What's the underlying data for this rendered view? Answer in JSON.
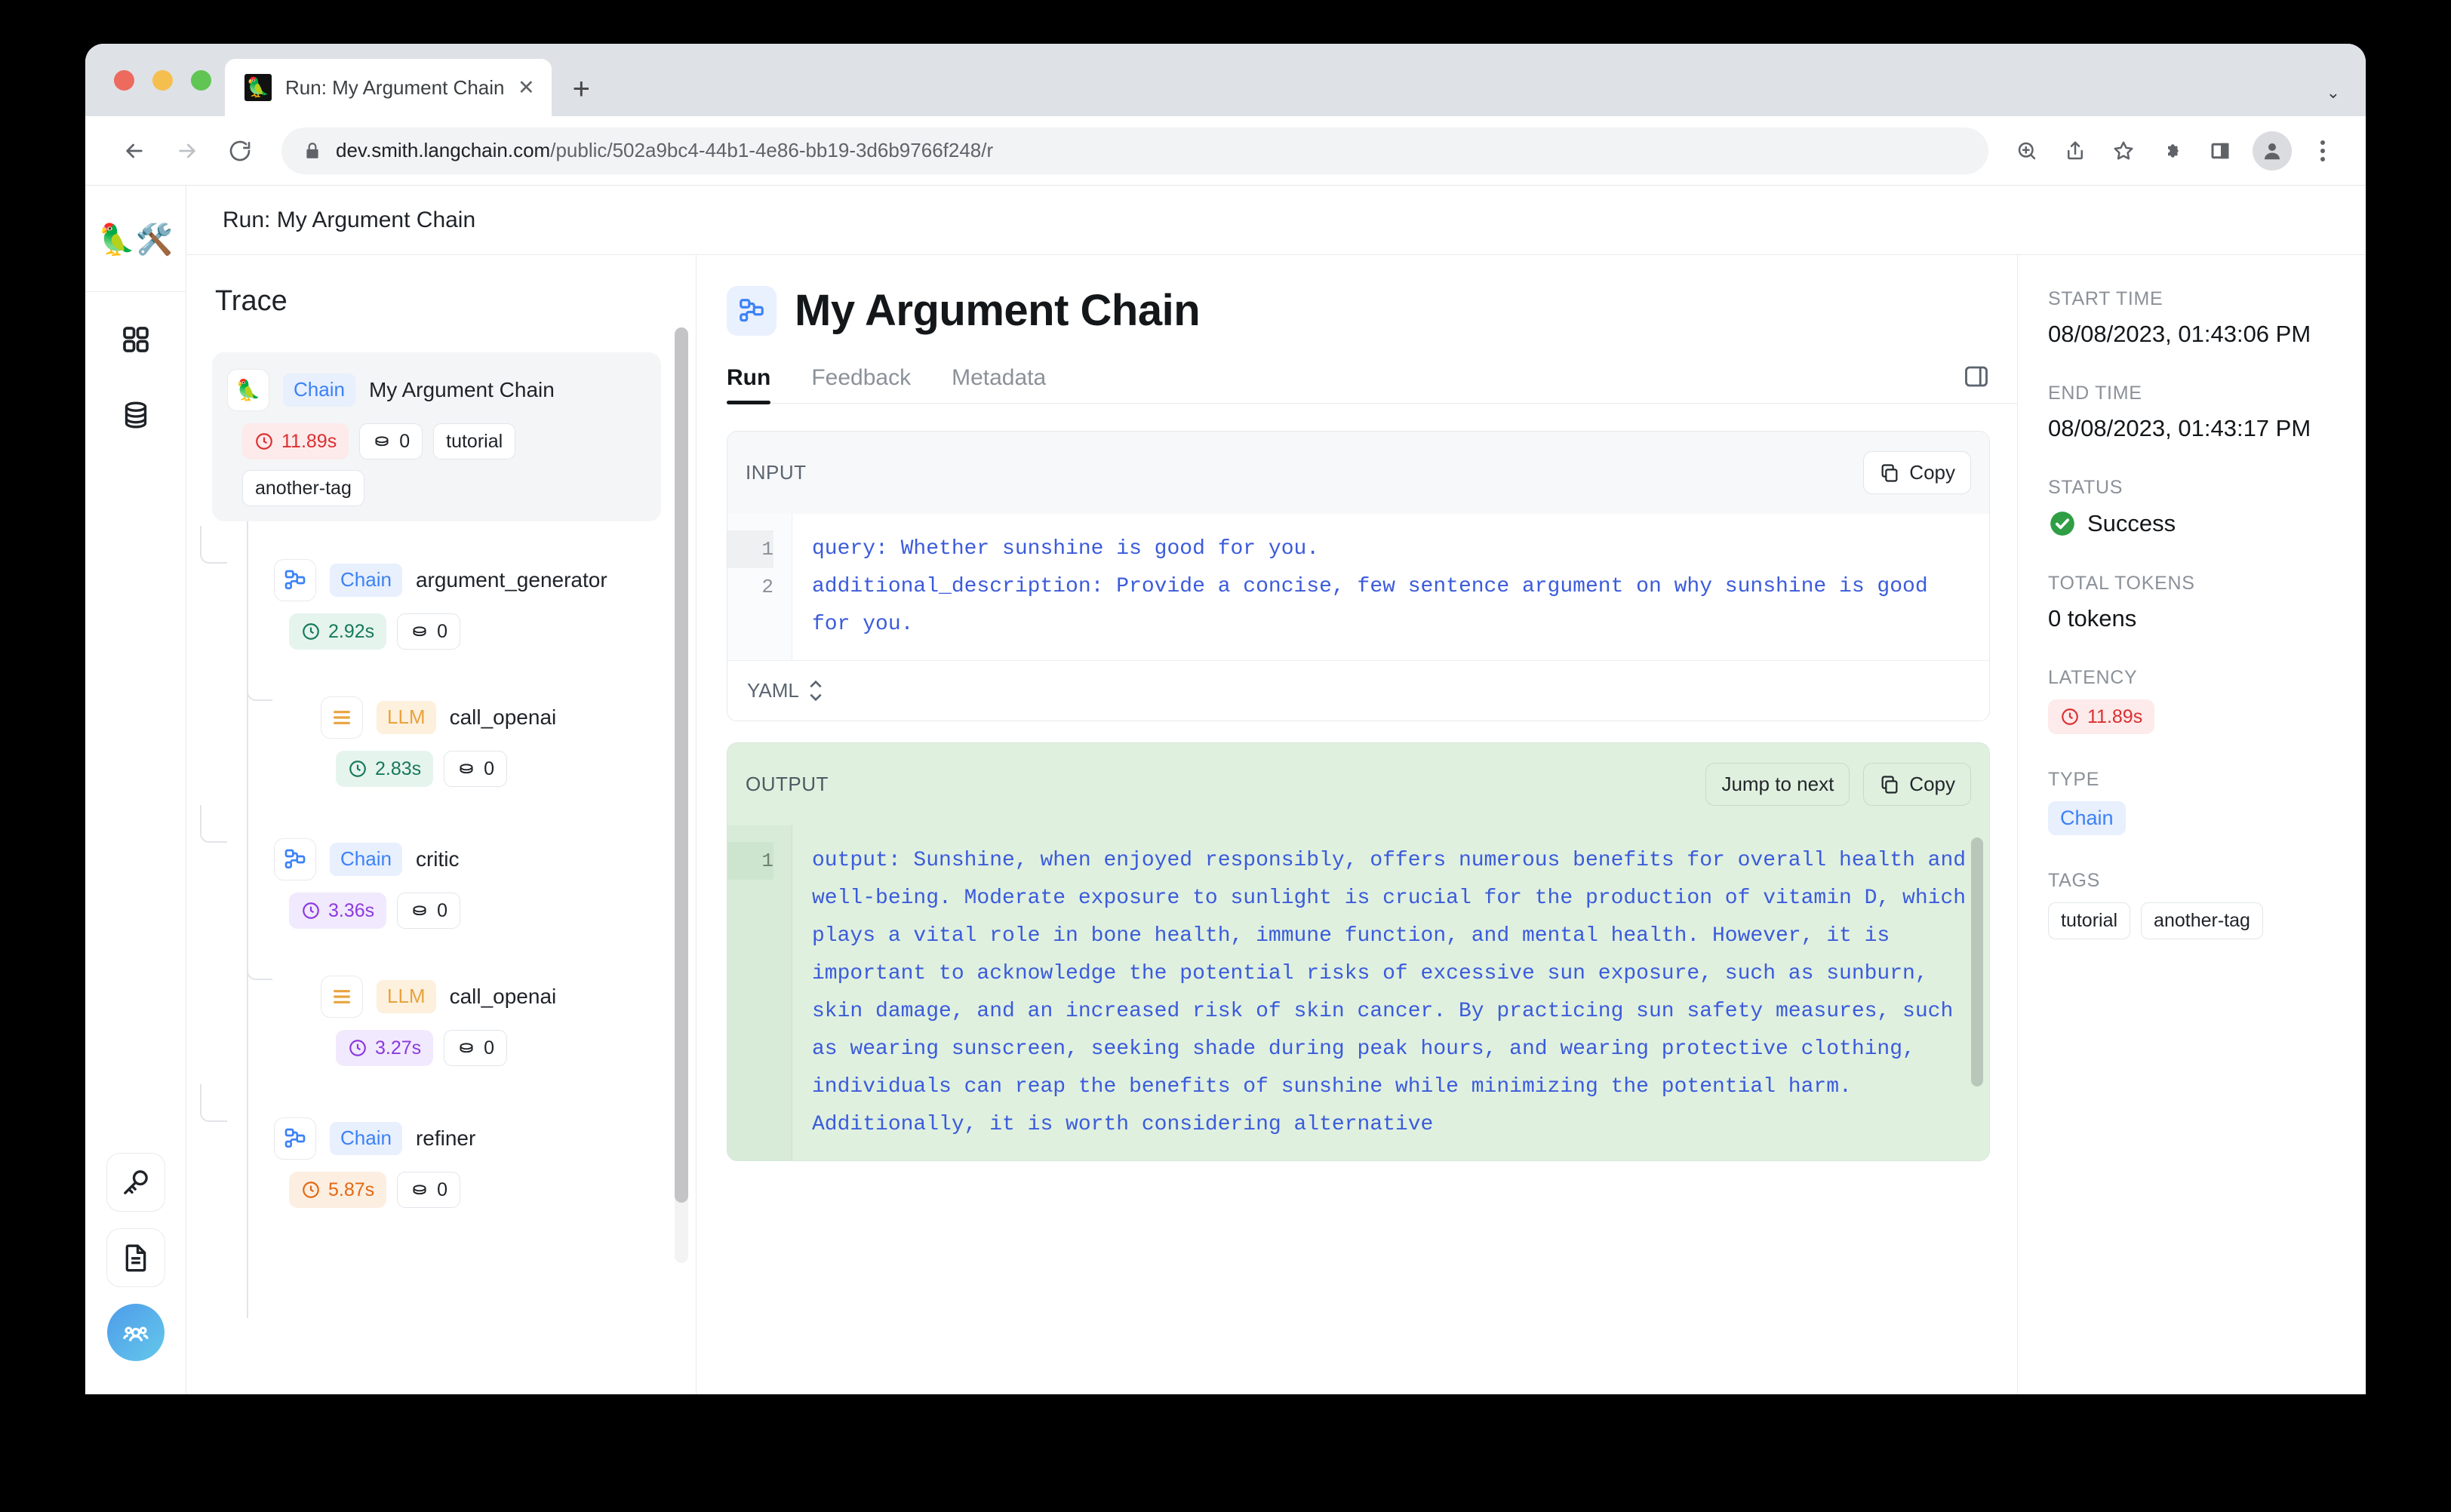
{
  "browser": {
    "tab": {
      "title": "Run: My Argument Chain - Lan",
      "favicon": "parrot-icon",
      "close_label": "✕"
    },
    "new_tab_label": "+",
    "tabstrip_menu": "⌄",
    "url_host": "dev.smith.langchain.com",
    "url_path": "/public/502a9bc4-44b1-4e86-bb19-3d6b9766f248/r",
    "lock_icon": "lock-icon",
    "back_label": "back-icon",
    "forward_label": "forward-icon",
    "reload_label": "reload-icon",
    "toolbar_icons": [
      "zoom-in-icon",
      "share-icon",
      "bookmark-star-icon",
      "extensions-puzzle-icon",
      "side-panel-icon",
      "profile-avatar-icon",
      "chrome-menu-icon"
    ]
  },
  "rail": {
    "logo": "🦜🛠️",
    "items": [
      {
        "name": "projects",
        "icon": "grid-icon"
      },
      {
        "name": "datasets",
        "icon": "database-icon"
      }
    ],
    "bottom_items": [
      {
        "name": "api-keys",
        "icon": "key-icon"
      },
      {
        "name": "docs",
        "icon": "document-icon"
      }
    ],
    "avatar": "organization-avatar"
  },
  "header": {
    "breadcrumb": "Run: My Argument Chain"
  },
  "trace": {
    "title": "Trace",
    "nodes": [
      {
        "type_badge": "Chain",
        "badge_kind": "chain",
        "name": "My Argument Chain",
        "icon": "parrot-icon",
        "latency": "11.89s",
        "latency_kind": "lat-red",
        "tokens": "0",
        "tags": [
          "tutorial",
          "another-tag"
        ],
        "depth": 0,
        "selected": true
      },
      {
        "type_badge": "Chain",
        "badge_kind": "chain",
        "name": "argument_generator",
        "icon": "chain-node-icon",
        "latency": "2.92s",
        "latency_kind": "lat-green",
        "tokens": "0",
        "tags": [],
        "depth": 1,
        "selected": false
      },
      {
        "type_badge": "LLM",
        "badge_kind": "llm",
        "name": "call_openai",
        "icon": "llm-icon",
        "latency": "2.83s",
        "latency_kind": "lat-green",
        "tokens": "0",
        "tags": [],
        "depth": 2,
        "selected": false
      },
      {
        "type_badge": "Chain",
        "badge_kind": "chain",
        "name": "critic",
        "icon": "chain-node-icon",
        "latency": "3.36s",
        "latency_kind": "lat-purple",
        "tokens": "0",
        "tags": [],
        "depth": 1,
        "selected": false
      },
      {
        "type_badge": "LLM",
        "badge_kind": "llm",
        "name": "call_openai",
        "icon": "llm-icon",
        "latency": "3.27s",
        "latency_kind": "lat-purple",
        "tokens": "0",
        "tags": [],
        "depth": 2,
        "selected": false
      },
      {
        "type_badge": "Chain",
        "badge_kind": "chain",
        "name": "refiner",
        "icon": "chain-node-icon",
        "latency": "5.87s",
        "latency_kind": "lat-orange",
        "tokens": "0",
        "tags": [],
        "depth": 1,
        "selected": false
      }
    ]
  },
  "run": {
    "title": "My Argument Chain",
    "title_icon": "chain-node-icon",
    "tabs": [
      {
        "label": "Run",
        "active": true
      },
      {
        "label": "Feedback",
        "active": false
      },
      {
        "label": "Metadata",
        "active": false
      }
    ],
    "panel_toggle_icon": "side-panel-toggle-icon"
  },
  "input": {
    "label": "INPUT",
    "copy_label": "Copy",
    "line_numbers": [
      "1",
      "2"
    ],
    "text": "query: Whether sunshine is good for you.\nadditional_description: Provide a concise, few sentence argument on why sunshine is good for you.",
    "format": "YAML"
  },
  "output": {
    "label": "OUTPUT",
    "jump_label": "Jump to next",
    "copy_label": "Copy",
    "line_numbers": [
      "1"
    ],
    "text": "output: Sunshine, when enjoyed responsibly, offers numerous benefits for overall health and well-being. Moderate exposure to sunlight is crucial for the production of vitamin D, which plays a vital role in bone health, immune function, and mental health. However, it is important to acknowledge the potential risks of excessive sun exposure, such as sunburn, skin damage, and an increased risk of skin cancer. By practicing sun safety measures, such as wearing sunscreen, seeking shade during peak hours, and wearing protective clothing, individuals can reap the benefits of sunshine while minimizing the potential harm. Additionally, it is worth considering alternative"
  },
  "meta": {
    "start_time_label": "START TIME",
    "start_time": "08/08/2023, 01:43:06 PM",
    "end_time_label": "END TIME",
    "end_time": "08/08/2023, 01:43:17 PM",
    "status_label": "STATUS",
    "status": "Success",
    "total_tokens_label": "TOTAL TOKENS",
    "total_tokens": "0 tokens",
    "latency_label": "LATENCY",
    "latency": "11.89s",
    "type_label": "TYPE",
    "type": "Chain",
    "tags_label": "TAGS",
    "tags": [
      "tutorial",
      "another-tag"
    ]
  },
  "colors": {
    "accent_blue": "#3b82f6",
    "llm_orange": "#e8a33d",
    "success_green": "#2f9e44",
    "latency_red": "#dc2f31",
    "output_bg": "#dff0df"
  }
}
